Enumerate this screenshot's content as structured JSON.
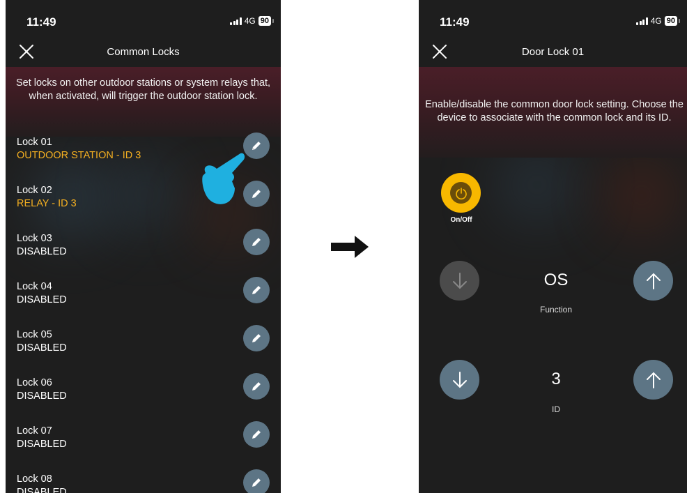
{
  "left_screen": {
    "status_bar": {
      "time": "11:49",
      "network": "4G",
      "battery": "90"
    },
    "title": "Common Locks",
    "description": "Set locks on other outdoor stations or system relays that, when activated, will trigger the outdoor station lock.",
    "locks": [
      {
        "name": "Lock 01",
        "status": "OUTDOOR STATION - ID 3",
        "active": true
      },
      {
        "name": "Lock 02",
        "status": "RELAY - ID 3",
        "active": true
      },
      {
        "name": "Lock 03",
        "status": "DISABLED",
        "active": false
      },
      {
        "name": "Lock 04",
        "status": "DISABLED",
        "active": false
      },
      {
        "name": "Lock 05",
        "status": "DISABLED",
        "active": false
      },
      {
        "name": "Lock 06",
        "status": "DISABLED",
        "active": false
      },
      {
        "name": "Lock 07",
        "status": "DISABLED",
        "active": false
      },
      {
        "name": "Lock 08",
        "status": "DISABLED",
        "active": false
      }
    ]
  },
  "right_screen": {
    "status_bar": {
      "time": "11:49",
      "network": "4G",
      "battery": "90"
    },
    "title": "Door Lock 01",
    "description": "Enable/disable the common door lock setting. Choose the device to associate with the common lock and its ID.",
    "power_label": "On/Off",
    "function": {
      "value": "OS",
      "label": "Function"
    },
    "id": {
      "value": "3",
      "label": "ID"
    }
  },
  "colors": {
    "accent": "#f8b800",
    "button": "#5d7585",
    "active_text": "#f5b021",
    "hand": "#1fb0e0"
  }
}
